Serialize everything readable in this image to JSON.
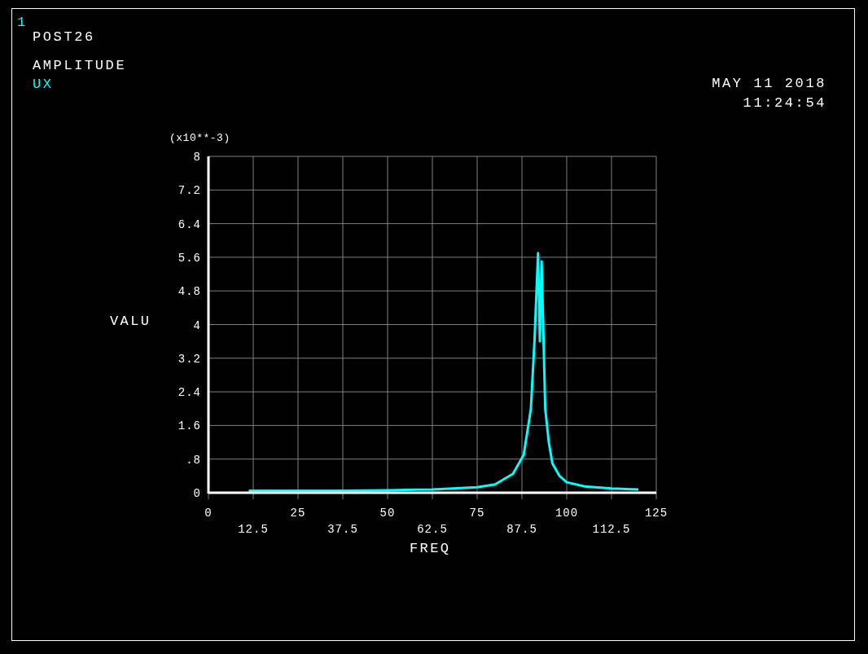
{
  "window": {
    "number": "1"
  },
  "header": {
    "processor": "POST26",
    "title": "AMPLITUDE",
    "variable": "UX",
    "date": "MAY 11 2018",
    "time": "11:24:54"
  },
  "plot": {
    "y_scale_label": "(x10**-3)",
    "x_tick_labels_lower_row": [
      "12.5",
      "37.5",
      "62.5",
      "87.5",
      "112.5"
    ],
    "chart_data": {
      "type": "line",
      "grid": true,
      "xlabel": "FREQ",
      "ylabel": "VALU",
      "xlim": [
        0,
        125
      ],
      "ylim": [
        0,
        8
      ],
      "xticks": [
        0,
        25,
        50,
        75,
        100,
        125
      ],
      "yticks": [
        0,
        {
          "value": 0.8,
          "label": ".8"
        },
        1.6,
        2.4,
        3.2,
        4,
        4.8,
        5.6,
        6.4,
        7.2,
        8
      ],
      "x": [
        11.25,
        25,
        37.5,
        50,
        62.5,
        75,
        80,
        85,
        88,
        90,
        91,
        92,
        92.5,
        93,
        94,
        95,
        96,
        98,
        100,
        105,
        112.5,
        120
      ],
      "series": [
        {
          "color": "#00ffff",
          "values": [
            0.05,
            0.05,
            0.05,
            0.06,
            0.08,
            0.13,
            0.2,
            0.45,
            0.9,
            2.0,
            3.6,
            5.7,
            3.6,
            5.5,
            2.0,
            1.2,
            0.7,
            0.4,
            0.25,
            0.15,
            0.1,
            0.08
          ]
        }
      ]
    }
  }
}
